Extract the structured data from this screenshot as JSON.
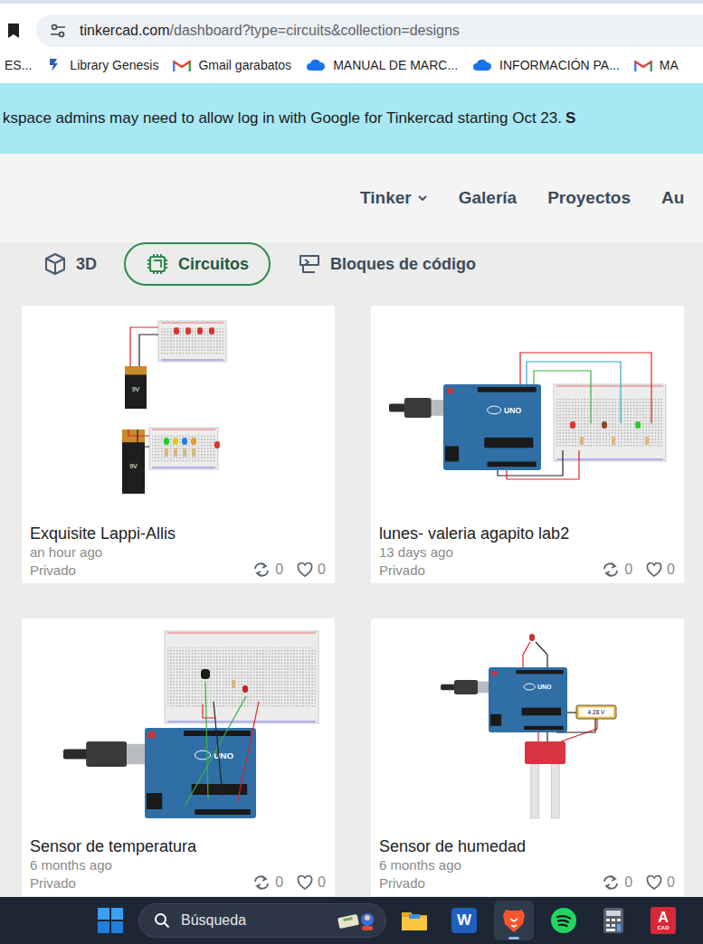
{
  "browser": {
    "url_host": "tinkercad.com",
    "url_path": "/dashboard?type=circuits&collection=designs",
    "bookmarks": [
      {
        "label": "ES...",
        "kind": "none"
      },
      {
        "label": "Library Genesis",
        "kind": "libgen"
      },
      {
        "label": "Gmail garabatos",
        "kind": "gmail"
      },
      {
        "label": "MANUAL DE MARC...",
        "kind": "onedrive"
      },
      {
        "label": "INFORMACIÓN PA...",
        "kind": "onedrive"
      },
      {
        "label": "MA",
        "kind": "gmail"
      }
    ]
  },
  "banner": {
    "text": "kspace admins may need to allow log in with Google for Tinkercad starting Oct 23.",
    "link": "S"
  },
  "nav": [
    {
      "label": "Tinker",
      "dropdown": true
    },
    {
      "label": "Galería",
      "dropdown": false
    },
    {
      "label": "Proyectos",
      "dropdown": false
    },
    {
      "label": "Au",
      "dropdown": false
    }
  ],
  "tabs": [
    {
      "label": "3D",
      "kind": "cube",
      "selected": false
    },
    {
      "label": "Circuitos",
      "kind": "chip",
      "selected": true
    },
    {
      "label": "Bloques de código",
      "kind": "blocks",
      "selected": false
    }
  ],
  "cards": [
    {
      "title": "Exquisite Lappi-Allis",
      "time": "an hour ago",
      "privacy": "Privado",
      "remixes": "0",
      "likes": "0",
      "thumbnail": {
        "kind": "battery",
        "battery_labels": [
          "9V",
          "9V"
        ]
      }
    },
    {
      "title": "lunes- valeria agapito lab2",
      "time": "13 days ago",
      "privacy": "Privado",
      "remixes": "0",
      "likes": "0",
      "thumbnail": {
        "kind": "arduino-leds",
        "board_label": "UNO"
      }
    },
    {
      "title": "Sensor de temperatura",
      "time": "6 months ago",
      "privacy": "Privado",
      "remixes": "0",
      "likes": "0",
      "thumbnail": {
        "kind": "arduino-temp",
        "board_label": "UNO"
      }
    },
    {
      "title": "Sensor de humedad",
      "time": "6 months ago",
      "privacy": "Privado",
      "remixes": "0",
      "likes": "0",
      "thumbnail": {
        "kind": "arduino-moisture",
        "board_label": "UNO",
        "meter_reading": "4.28 V"
      }
    }
  ],
  "taskbar": {
    "search_placeholder": "Búsqueda",
    "apps": [
      {
        "kind": "folder",
        "label": "",
        "sublabel": "",
        "selected": false
      },
      {
        "kind": "word",
        "label": "W",
        "sublabel": "",
        "selected": false
      },
      {
        "kind": "brave",
        "label": "",
        "sublabel": "",
        "selected": true
      },
      {
        "kind": "spotify",
        "label": "",
        "sublabel": "",
        "selected": false
      },
      {
        "kind": "calculator",
        "label": "",
        "sublabel": "",
        "selected": false
      },
      {
        "kind": "autocad",
        "label": "A",
        "sublabel": "CAD",
        "selected": false
      }
    ]
  }
}
